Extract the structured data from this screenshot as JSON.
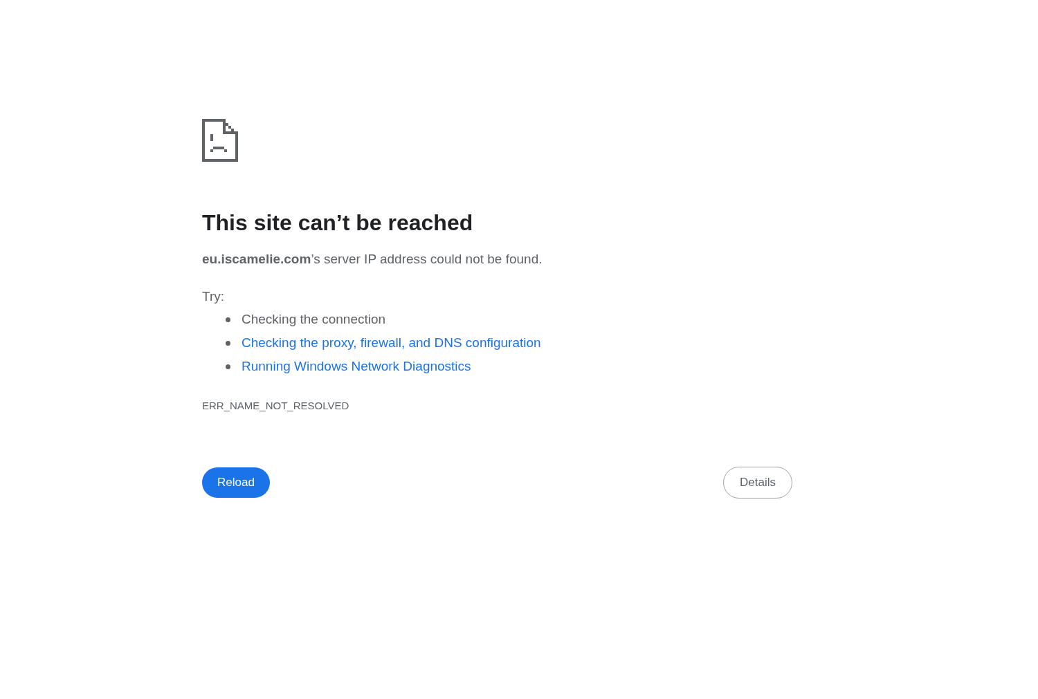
{
  "heading": "This site can’t be reached",
  "description": "**eu.iscamelie.com**’s server IP address could not be found.",
  "try_label": "Try:",
  "suggestions": [
    {
      "kind": "text",
      "label": "Checking the connection"
    },
    {
      "kind": "link",
      "label": "Checking the proxy, firewall, and DNS configuration"
    },
    {
      "kind": "link",
      "label": "Running Windows Network Diagnostics"
    }
  ],
  "error_code": "ERR_NAME_NOT_RESOLVED",
  "buttons": [
    {
      "kind": "primary",
      "label": "Reload"
    },
    {
      "kind": "secondary",
      "label": "Details"
    }
  ]
}
